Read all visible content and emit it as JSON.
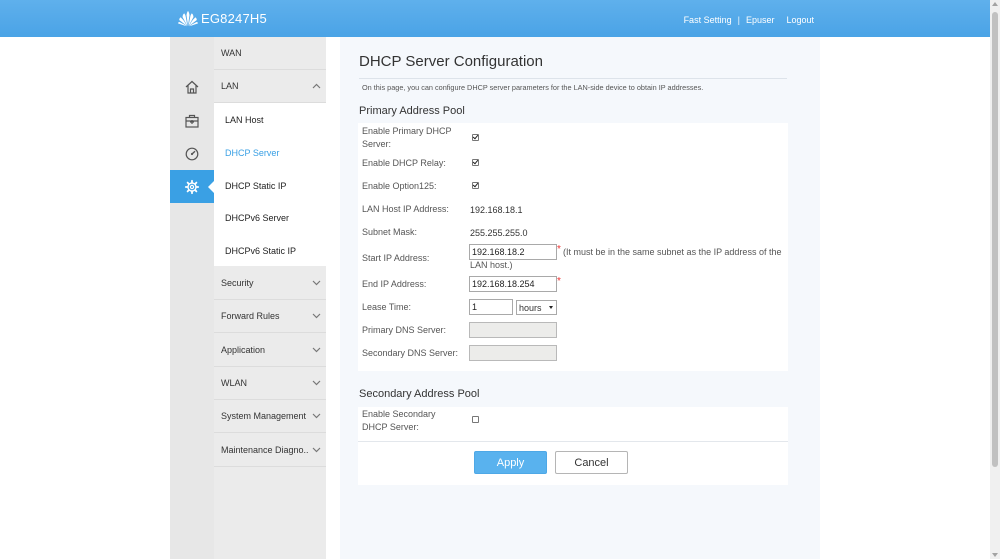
{
  "header": {
    "product": "EG8247H5",
    "links": [
      "Fast Setting",
      "Epuser",
      "Logout"
    ],
    "separator": "|",
    "colors": {
      "bar": "#4aa3e6"
    }
  },
  "iconstrip": {
    "items": [
      {
        "icon": "home-icon"
      },
      {
        "icon": "toolbox-icon"
      },
      {
        "icon": "gauge-icon"
      },
      {
        "icon": "gear-icon",
        "active": true
      }
    ]
  },
  "menu": {
    "top": "WAN",
    "lan": "LAN",
    "lan_items": [
      "LAN Host",
      "DHCP Server",
      "DHCP Static IP",
      "DHCPv6 Server",
      "DHCPv6 Static IP"
    ],
    "active_sub": "DHCP Server",
    "rest": [
      "Security",
      "Forward Rules",
      "Application",
      "WLAN",
      "System Management",
      "Maintenance Diagno.."
    ]
  },
  "page": {
    "title": "DHCP Server Configuration",
    "description": "On this page, you can configure DHCP server parameters for the LAN-side device to obtain IP addresses.",
    "primary": {
      "title": "Primary Address Pool",
      "enable_primary_label": "Enable Primary DHCP Server:",
      "enable_primary_checked": true,
      "enable_relay_label": "Enable DHCP Relay:",
      "enable_relay_checked": true,
      "enable_opt125_label": "Enable Option125:",
      "enable_opt125_checked": true,
      "lan_host_ip_label": "LAN Host IP Address:",
      "lan_host_ip": "192.168.18.1",
      "subnet_mask_label": "Subnet Mask:",
      "subnet_mask": "255.255.255.0",
      "start_ip_label": "Start IP Address:",
      "start_ip": "192.168.18.2",
      "start_ip_note": "(It must be in the same subnet as the IP address of the LAN host.)",
      "end_ip_label": "End IP Address:",
      "end_ip": "192.168.18.254",
      "lease_label": "Lease Time:",
      "lease_value": "1",
      "lease_unit": "hours",
      "primary_dns_label": "Primary DNS Server:",
      "primary_dns": "",
      "secondary_dns_label": "Secondary DNS Server:",
      "secondary_dns": "",
      "required_mark": "*"
    },
    "secondary": {
      "title": "Secondary Address Pool",
      "enable_label": "Enable Secondary DHCP Server:",
      "enable_checked": false
    },
    "buttons": {
      "apply": "Apply",
      "cancel": "Cancel"
    },
    "colors": {
      "accent": "#3aa0e4",
      "apply": "#59b2ee",
      "required": "#e33333"
    }
  }
}
